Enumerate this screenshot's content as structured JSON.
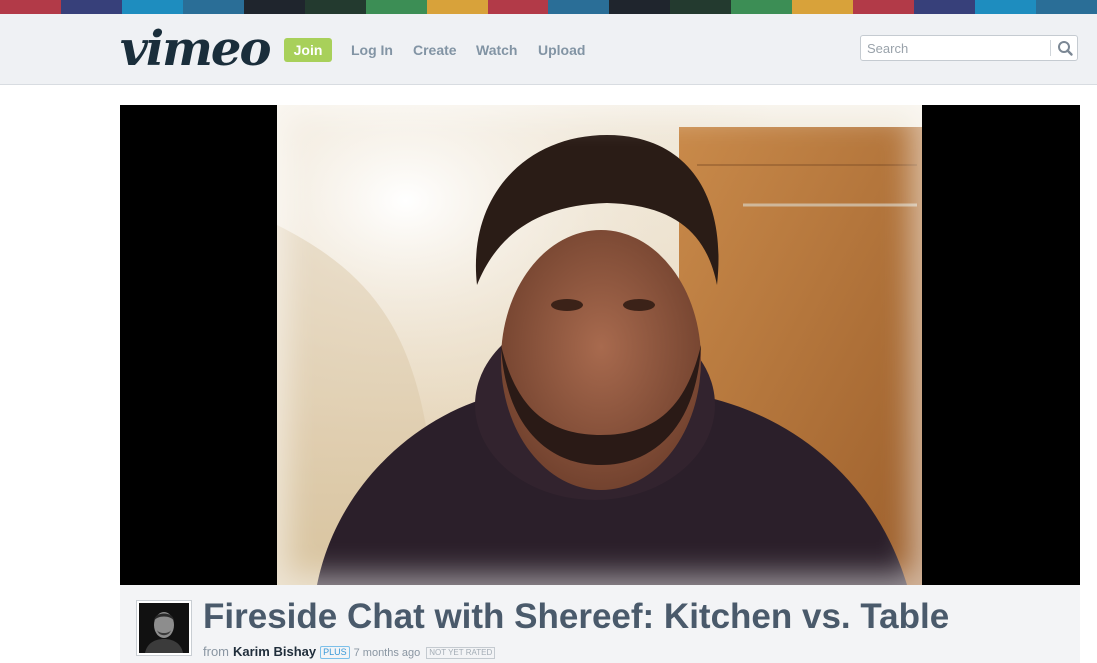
{
  "colors": {
    "stripe": [
      "#b23a48",
      "#37407a",
      "#1e8dbf",
      "#2a6e97",
      "#1f252d",
      "#233a2f",
      "#3c8e55",
      "#d8a23a",
      "#b23a48",
      "#2a6e97",
      "#1f252d",
      "#233a2f",
      "#3c8e55",
      "#d8a23a",
      "#b23a48",
      "#37407a",
      "#1e8dbf",
      "#2a6e97"
    ],
    "join_bg": "#a8d05a",
    "nav_text": "#8294a4",
    "title_text": "#4a5a6b"
  },
  "header": {
    "logo": "vimeo",
    "nav": {
      "join": "Join",
      "login": "Log In",
      "create": "Create",
      "watch": "Watch",
      "upload": "Upload"
    },
    "search": {
      "placeholder": "Search",
      "value": "",
      "icon": "search-icon"
    }
  },
  "video": {
    "title": "Fireside Chat with Shereef: Kitchen vs. Table",
    "from_label": "from",
    "author": "Karim Bishay",
    "author_badge": "PLUS",
    "age": "7 months ago",
    "rating": "NOT YET RATED"
  }
}
